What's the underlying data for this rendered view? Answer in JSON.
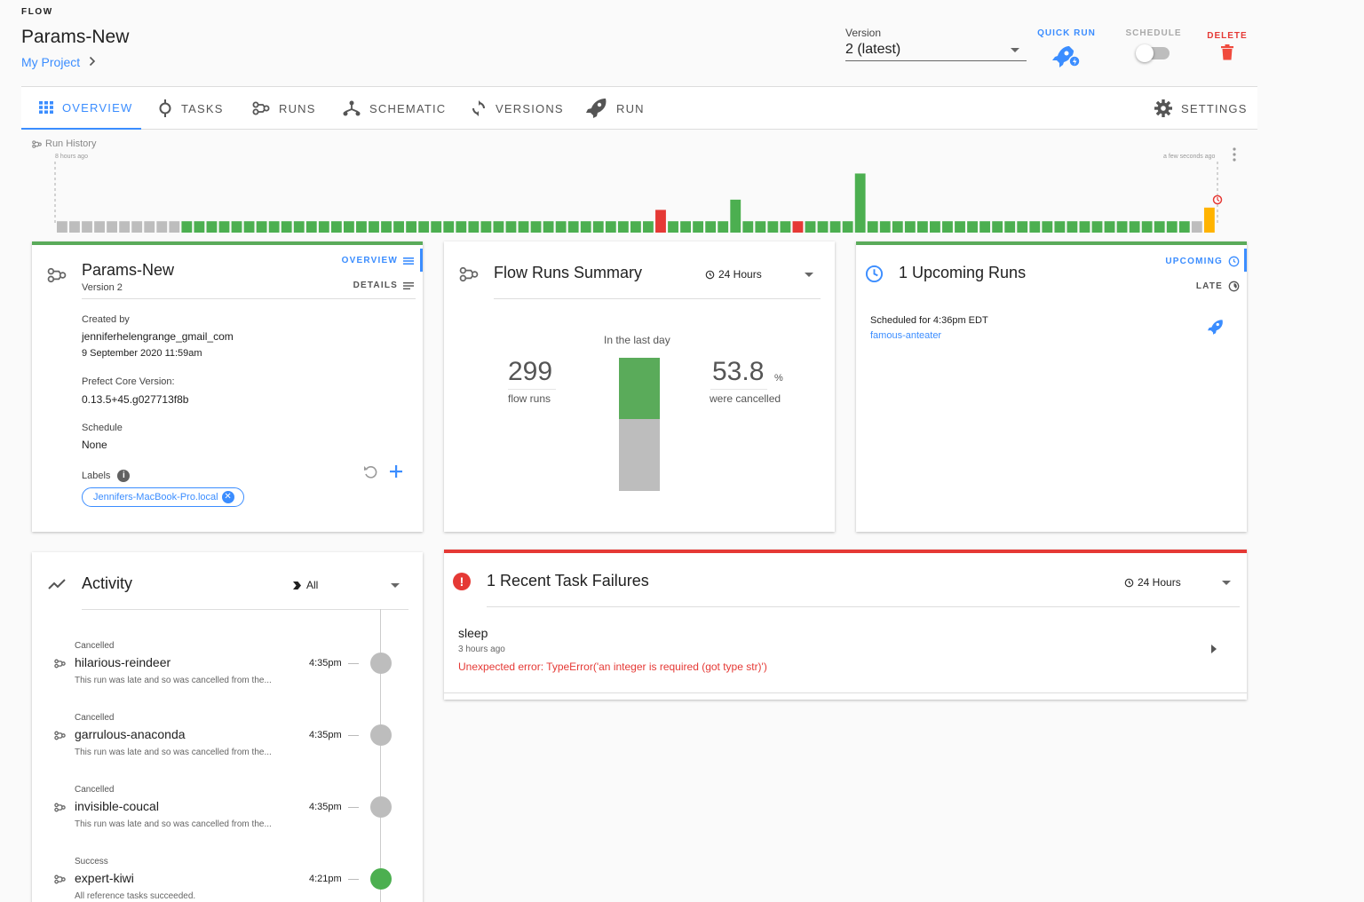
{
  "header": {
    "eyebrow": "FLOW",
    "title": "Params-New",
    "breadcrumb": "My Project",
    "version_label": "Version",
    "version_value": "2 (latest)",
    "quick_run": "QUICK RUN",
    "schedule": "SCHEDULE",
    "delete": "DELETE"
  },
  "tabs": [
    {
      "label": "OVERVIEW"
    },
    {
      "label": "TASKS"
    },
    {
      "label": "RUNS"
    },
    {
      "label": "SCHEMATIC"
    },
    {
      "label": "VERSIONS"
    },
    {
      "label": "RUN"
    },
    {
      "label": "SETTINGS"
    }
  ],
  "run_history": {
    "label": "Run History",
    "start": "8 hours ago",
    "end": "a few seconds ago",
    "colors": {
      "grey": "#bdbdbd",
      "green": "#4caf50",
      "red": "#e53935",
      "orange": "#ffb300"
    },
    "bars": [
      [
        "grey",
        1
      ],
      [
        "grey",
        1
      ],
      [
        "grey",
        1
      ],
      [
        "grey",
        1
      ],
      [
        "grey",
        1
      ],
      [
        "grey",
        1
      ],
      [
        "grey",
        1
      ],
      [
        "grey",
        1
      ],
      [
        "grey",
        1
      ],
      [
        "grey",
        1
      ],
      [
        "green",
        1
      ],
      [
        "green",
        1
      ],
      [
        "green",
        1
      ],
      [
        "green",
        1
      ],
      [
        "green",
        1
      ],
      [
        "green",
        1
      ],
      [
        "green",
        1
      ],
      [
        "green",
        1
      ],
      [
        "green",
        1
      ],
      [
        "green",
        1
      ],
      [
        "green",
        1
      ],
      [
        "green",
        1
      ],
      [
        "green",
        1
      ],
      [
        "green",
        1
      ],
      [
        "green",
        1
      ],
      [
        "green",
        1
      ],
      [
        "green",
        1
      ],
      [
        "green",
        1
      ],
      [
        "green",
        1
      ],
      [
        "green",
        1
      ],
      [
        "green",
        1
      ],
      [
        "green",
        1
      ],
      [
        "green",
        1
      ],
      [
        "green",
        1
      ],
      [
        "green",
        1
      ],
      [
        "green",
        1
      ],
      [
        "green",
        1
      ],
      [
        "green",
        1
      ],
      [
        "green",
        1
      ],
      [
        "green",
        1
      ],
      [
        "green",
        1
      ],
      [
        "green",
        1
      ],
      [
        "green",
        1
      ],
      [
        "green",
        1
      ],
      [
        "green",
        1
      ],
      [
        "green",
        1
      ],
      [
        "green",
        1
      ],
      [
        "green",
        1
      ],
      [
        "red",
        2
      ],
      [
        "green",
        1
      ],
      [
        "green",
        1
      ],
      [
        "green",
        1
      ],
      [
        "green",
        1
      ],
      [
        "green",
        1
      ],
      [
        "green",
        2.9
      ],
      [
        "green",
        1
      ],
      [
        "green",
        1
      ],
      [
        "green",
        1
      ],
      [
        "green",
        1
      ],
      [
        "red",
        1
      ],
      [
        "green",
        1
      ],
      [
        "green",
        1
      ],
      [
        "green",
        1
      ],
      [
        "green",
        1
      ],
      [
        "green",
        5.2
      ],
      [
        "green",
        1
      ],
      [
        "green",
        1
      ],
      [
        "green",
        1
      ],
      [
        "green",
        1
      ],
      [
        "green",
        1
      ],
      [
        "green",
        1
      ],
      [
        "green",
        1
      ],
      [
        "green",
        1
      ],
      [
        "green",
        1
      ],
      [
        "green",
        1
      ],
      [
        "green",
        1
      ],
      [
        "green",
        1
      ],
      [
        "green",
        1
      ],
      [
        "green",
        1
      ],
      [
        "green",
        1
      ],
      [
        "green",
        1
      ],
      [
        "green",
        1
      ],
      [
        "green",
        1
      ],
      [
        "green",
        1
      ],
      [
        "green",
        1
      ],
      [
        "green",
        1
      ],
      [
        "green",
        1
      ],
      [
        "green",
        1
      ],
      [
        "green",
        1
      ],
      [
        "green",
        1
      ],
      [
        "green",
        1
      ],
      [
        "grey",
        1
      ],
      [
        "orange",
        2.2
      ]
    ]
  },
  "flow_card": {
    "title": "Params-New",
    "version": "Version 2",
    "overview_tab": "OVERVIEW",
    "details_tab": "DETAILS",
    "created_by_label": "Created by",
    "created_by": "jenniferhelengrange_gmail_com",
    "created_at": "9 September 2020 11:59am",
    "core_version_label": "Prefect Core Version:",
    "core_version": "0.13.5+45.g027713f8b",
    "schedule_label": "Schedule",
    "schedule_value": "None",
    "labels_label": "Labels",
    "label_chip": "Jennifers-MacBook-Pro.local"
  },
  "summary_card": {
    "title": "Flow Runs Summary",
    "range": "24 Hours",
    "subtitle": "In the last day",
    "flow_runs": "299",
    "flow_runs_label": "flow runs",
    "percent": "53.8",
    "percent_sign": "%",
    "percent_label": "were cancelled",
    "bar": {
      "success_fraction": 0.46,
      "cancelled_fraction": 0.54,
      "success_color": "#5aab5a",
      "cancelled_color": "#bdbdbd"
    }
  },
  "upcoming_card": {
    "title": "1 Upcoming Runs",
    "upcoming_tab": "UPCOMING",
    "late_tab": "LATE",
    "scheduled_text": "Scheduled for 4:36pm EDT",
    "run_name": "famous-anteater"
  },
  "activity_card": {
    "title": "Activity",
    "filter": "All",
    "items": [
      {
        "state": "Cancelled",
        "name": "hilarious-reindeer",
        "message": "This run was late and so was cancelled from the...",
        "time": "4:35pm",
        "color": "#bdbdbd"
      },
      {
        "state": "Cancelled",
        "name": "garrulous-anaconda",
        "message": "This run was late and so was cancelled from the...",
        "time": "4:35pm",
        "color": "#bdbdbd"
      },
      {
        "state": "Cancelled",
        "name": "invisible-coucal",
        "message": "This run was late and so was cancelled from the...",
        "time": "4:35pm",
        "color": "#bdbdbd"
      },
      {
        "state": "Success",
        "name": "expert-kiwi",
        "message": "All reference tasks succeeded.",
        "time": "4:21pm",
        "color": "#4caf50"
      }
    ]
  },
  "failures_card": {
    "title": "1 Recent Task Failures",
    "range": "24 Hours",
    "task": "sleep",
    "ago": "3 hours ago",
    "error": "Unexpected error: TypeError('an integer is required (got type str)')"
  },
  "colors": {
    "accent": "#3b8dff",
    "success": "#4caf50",
    "error": "#e53935"
  }
}
